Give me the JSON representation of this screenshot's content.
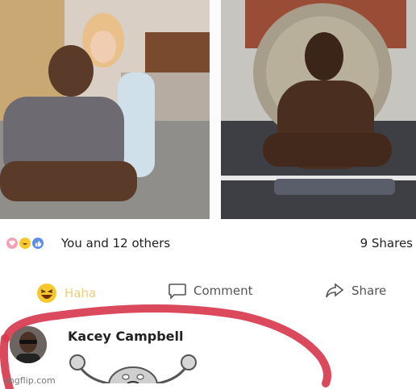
{
  "post": {
    "reactions": {
      "icons": [
        "love-icon",
        "haha-icon",
        "like-icon"
      ],
      "summary": "You and 12 others",
      "shares": "9 Shares"
    },
    "actions": {
      "haha_label": "Haha",
      "comment_label": "Comment",
      "share_label": "Share"
    }
  },
  "comment": {
    "author": "Kacey Campbell",
    "sticker": "rock-creature-sticker"
  },
  "watermark": "imgflip.com",
  "colors": {
    "highlight_red": "#d83a4e",
    "haha_yellow": "#f7c82e",
    "love_pink": "#f3a1b6",
    "like_blue": "#5c8ee6"
  }
}
